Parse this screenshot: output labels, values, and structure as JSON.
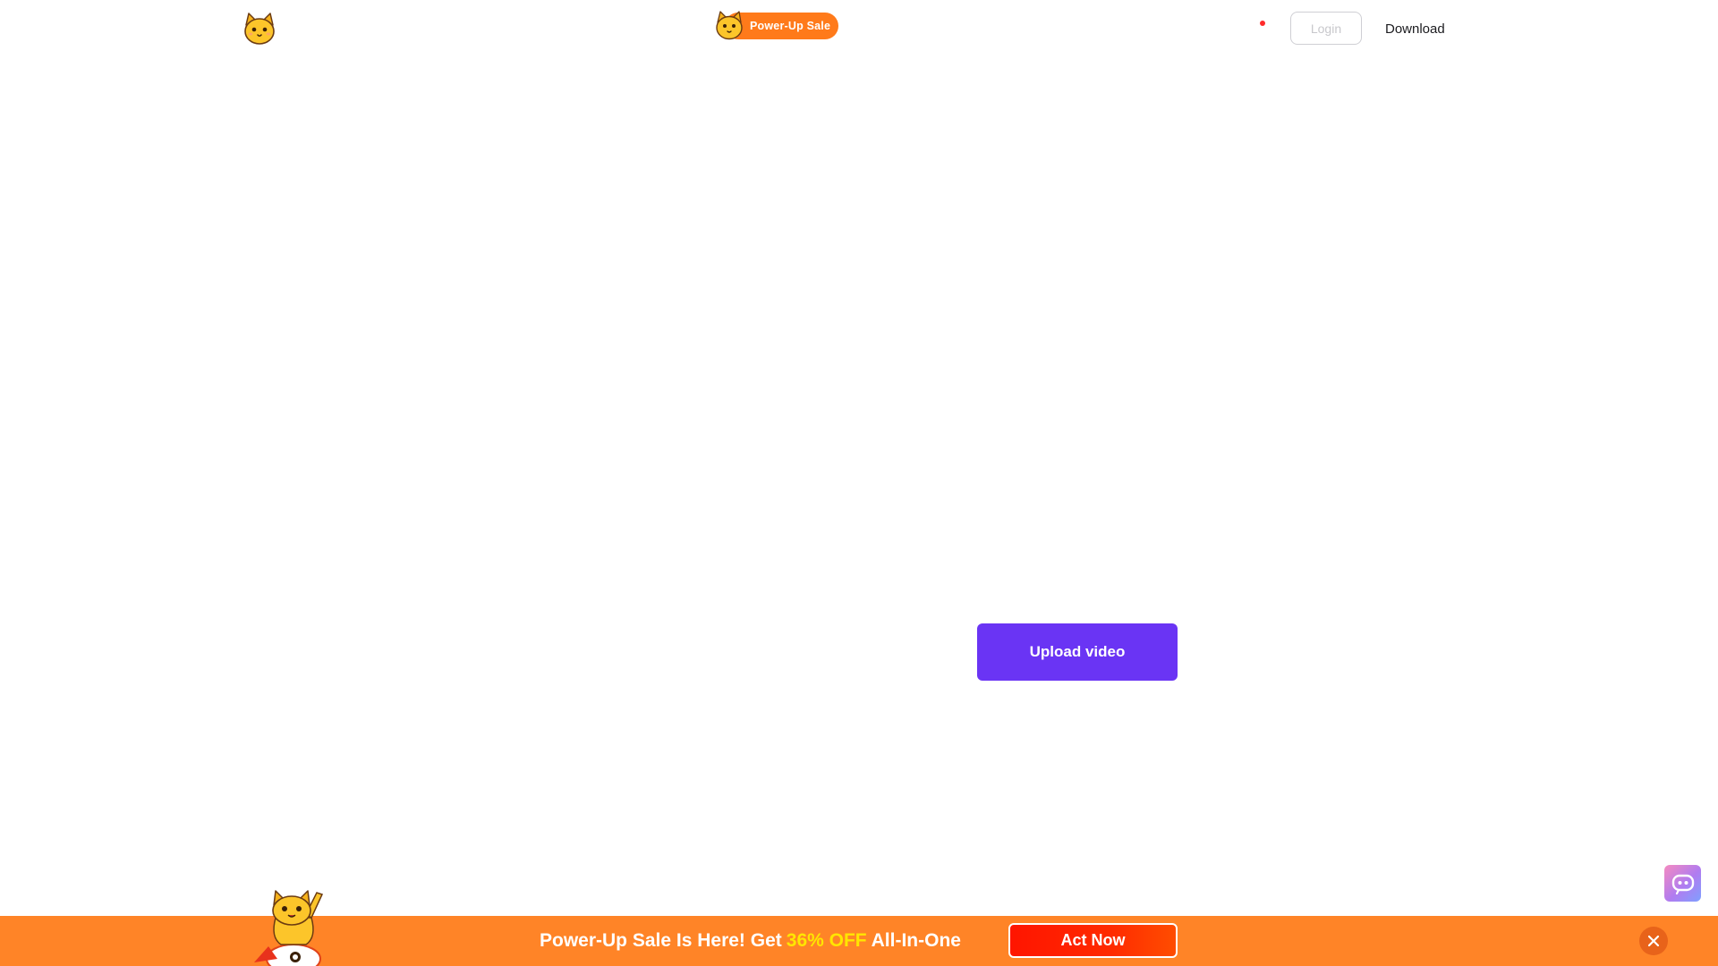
{
  "header": {
    "logo_icon": "cat-logo-icon",
    "promo_label": "Power-Up Sale",
    "login_label": "Login",
    "download_label": "Download"
  },
  "main": {
    "upload_label": "Upload video"
  },
  "assistant": {
    "icon": "robot-assistant-icon"
  },
  "banner": {
    "text_before": "Power-Up Sale Is Here! Get",
    "highlight": "36% OFF",
    "text_after": "All-In-One",
    "cta_label": "Act Now",
    "close_icon": "close-icon"
  },
  "colors": {
    "accent_purple": "#6a34f4",
    "promo_orange": "#ff8427",
    "cta_red": "#ff1500",
    "highlight_yellow": "#ffe600"
  }
}
